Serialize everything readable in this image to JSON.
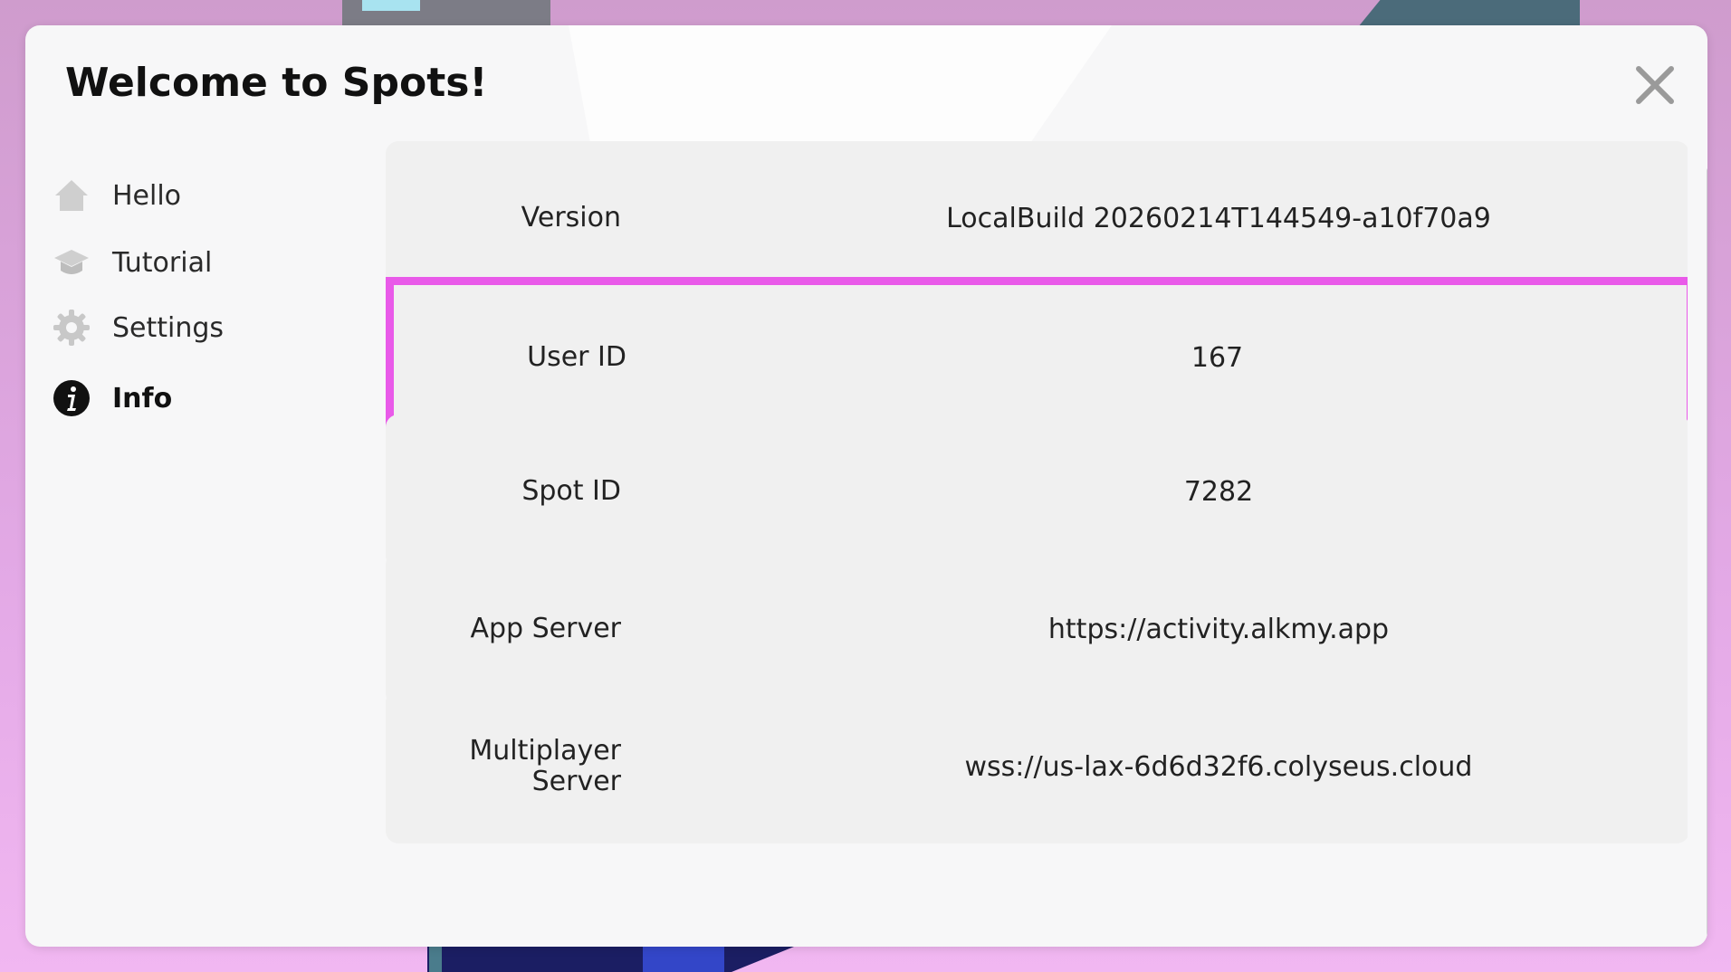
{
  "dialog": {
    "title": "Welcome to Spots!",
    "close_icon": "close-icon"
  },
  "sidebar": {
    "items": [
      {
        "label": "Hello",
        "icon": "home-icon",
        "active": false
      },
      {
        "label": "Tutorial",
        "icon": "graduation-cap-icon",
        "active": false
      },
      {
        "label": "Settings",
        "icon": "gear-icon",
        "active": false
      },
      {
        "label": "Info",
        "icon": "info-icon",
        "active": true
      }
    ]
  },
  "info_rows": [
    {
      "label": "Version",
      "value": "LocalBuild 20260214T144549-a10f70a9"
    },
    {
      "label": "User ID",
      "value": "167",
      "selected": true
    },
    {
      "label": "Spot ID",
      "value": "7282"
    },
    {
      "label": "App Server",
      "value": "https://activity.alkmy.app"
    },
    {
      "label_line1": "Multiplayer",
      "label_line2": "Server",
      "value": "wss://us-lax-6d6d32f6.colyseus.cloud"
    }
  ],
  "colors": {
    "selection_border": "#e95ae9",
    "row_background": "#f0f0f0",
    "dialog_background": "#f7f7f8"
  }
}
